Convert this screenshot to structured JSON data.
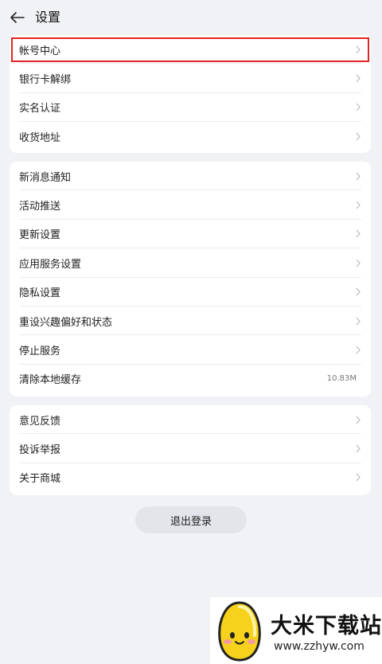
{
  "header": {
    "title": "设置"
  },
  "group1": [
    {
      "label": "帐号中心"
    },
    {
      "label": "银行卡解绑"
    },
    {
      "label": "实名认证"
    },
    {
      "label": "收货地址"
    }
  ],
  "group2": [
    {
      "label": "新消息通知"
    },
    {
      "label": "活动推送"
    },
    {
      "label": "更新设置"
    },
    {
      "label": "应用服务设置"
    },
    {
      "label": "隐私设置"
    },
    {
      "label": "重设兴趣偏好和状态"
    },
    {
      "label": "停止服务"
    },
    {
      "label": "清除本地缓存",
      "value": "10.83M"
    }
  ],
  "group3": [
    {
      "label": "意见反馈"
    },
    {
      "label": "投诉举报"
    },
    {
      "label": "关于商城"
    }
  ],
  "logout_label": "退出登录",
  "watermark": {
    "title": "大米下载站",
    "url": "www.zzhyw.com"
  },
  "colors": {
    "background": "#f1f2f5",
    "highlight": "#e42424",
    "chevron": "#bbbbbb"
  },
  "icons": {
    "back": "arrow-left-icon",
    "chevron": "chevron-right-icon"
  }
}
